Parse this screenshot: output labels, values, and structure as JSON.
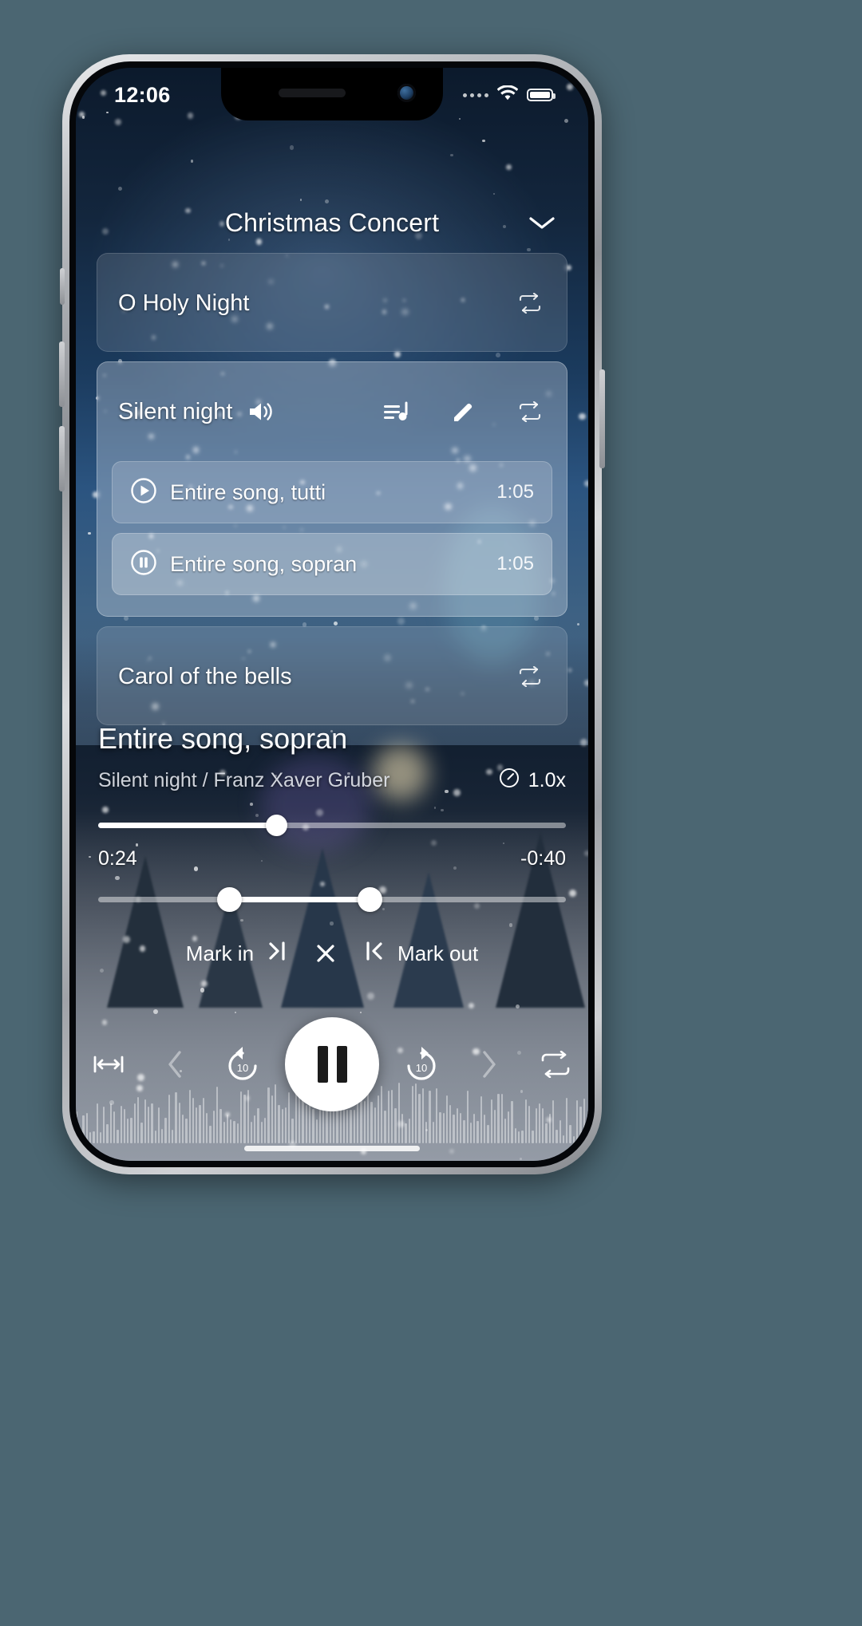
{
  "status_bar": {
    "time": "12:06",
    "cellular_icon": "cellular-dots-icon",
    "wifi_icon": "wifi-icon",
    "battery_icon": "battery-full-icon"
  },
  "header": {
    "title": "Christmas Concert",
    "collapse_icon": "chevron-down-icon"
  },
  "songs": [
    {
      "title": "O Holy Night",
      "expanded": false,
      "repeat_icon": "repeat-icon",
      "tracks": []
    },
    {
      "title": "Silent night",
      "expanded": true,
      "speaker_icon": "speaker-on-icon",
      "queue_icon": "playlist-music-icon",
      "edit_icon": "pencil-icon",
      "repeat_icon": "repeat-icon",
      "tracks": [
        {
          "label": "Entire song, tutti",
          "duration": "1:05",
          "state_icon": "play-circle-icon",
          "active": false
        },
        {
          "label": "Entire song, sopran",
          "duration": "1:05",
          "state_icon": "pause-circle-icon",
          "active": true
        }
      ]
    },
    {
      "title": "Carol of the bells",
      "expanded": false,
      "repeat_icon": "repeat-icon",
      "tracks": []
    }
  ],
  "now_playing": {
    "title": "Entire song, sopran",
    "subtitle": "Silent night / Franz Xaver Gruber",
    "speed_icon": "speedometer-icon",
    "speed_label": "1.0x",
    "elapsed": "0:24",
    "remaining": "-0:40",
    "progress_percent": 38,
    "range_start_percent": 28,
    "range_end_percent": 58
  },
  "marks": {
    "mark_in_label": "Mark in",
    "mark_in_icon": "mark-in-icon",
    "clear_icon": "close-x-icon",
    "mark_out_icon": "mark-out-icon",
    "mark_out_label": "Mark out"
  },
  "transport": {
    "fit_icon": "fit-to-range-icon",
    "prev_icon": "chevron-left-icon",
    "rewind_icon": "replay-10-icon",
    "rewind_label": "10",
    "play_pause_icon": "pause-icon",
    "forward_icon": "forward-10-icon",
    "forward_label": "10",
    "next_icon": "chevron-right-icon",
    "repeat_icon": "repeat-icon"
  },
  "colors": {
    "accent": "#ffffff",
    "card_bg": "rgba(255,255,255,0.13)",
    "card_bg_active": "rgba(235,242,252,0.30)",
    "screen_bg": "#0d1b2d"
  }
}
